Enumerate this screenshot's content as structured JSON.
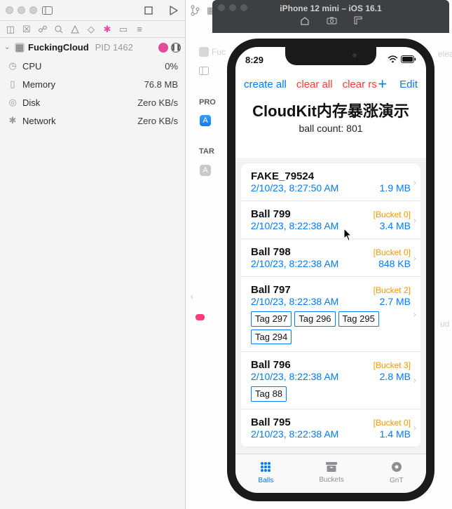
{
  "xcode": {
    "process_name": "FuckingCloud",
    "pid_label": "PID 1462",
    "metrics": [
      {
        "name": "CPU",
        "value": "0%",
        "icon": "gauge"
      },
      {
        "name": "Memory",
        "value": "76.8 MB",
        "icon": "memory"
      },
      {
        "name": "Disk",
        "value": "Zero KB/s",
        "icon": "disk"
      },
      {
        "name": "Network",
        "value": "Zero KB/s",
        "icon": "network"
      }
    ]
  },
  "simulator": {
    "title": "iPhone 12 mini – iOS 16.1"
  },
  "background": {
    "pro_label": "PRO",
    "tar_label": "TAR",
    "fuck_label": "Fuc",
    "release_fragment": "eleas",
    "ud_fragment": "ud"
  },
  "phone": {
    "time": "8:29",
    "nav": {
      "create_all": "create all",
      "clear_all": "clear all",
      "clear_rs": "clear rs",
      "edit": "Edit"
    },
    "title": "CloudKit内存暴涨演示",
    "subtitle": "ball count: 801",
    "rows": [
      {
        "name": "FAKE_79524",
        "bucket": "",
        "date": "2/10/23, 8:27:50 AM",
        "size": "1.9 MB",
        "tags": []
      },
      {
        "name": "Ball 799",
        "bucket": "[Bucket 0]",
        "date": "2/10/23, 8:22:38 AM",
        "size": "3.4 MB",
        "tags": []
      },
      {
        "name": "Ball 798",
        "bucket": "[Bucket 0]",
        "date": "2/10/23, 8:22:38 AM",
        "size": "848 KB",
        "tags": []
      },
      {
        "name": "Ball 797",
        "bucket": "[Bucket 2]",
        "date": "2/10/23, 8:22:38 AM",
        "size": "2.7 MB",
        "tags": [
          "Tag 297",
          "Tag 296",
          "Tag 295",
          "Tag 294"
        ]
      },
      {
        "name": "Ball 796",
        "bucket": "[Bucket 3]",
        "date": "2/10/23, 8:22:38 AM",
        "size": "2.8 MB",
        "tags": [
          "Tag 88"
        ]
      },
      {
        "name": "Ball 795",
        "bucket": "[Bucket 0]",
        "date": "2/10/23, 8:22:38 AM",
        "size": "1.4 MB",
        "tags": []
      }
    ],
    "tabs": {
      "balls": "Balls",
      "buckets": "Buckets",
      "gnt": "GnT"
    }
  }
}
